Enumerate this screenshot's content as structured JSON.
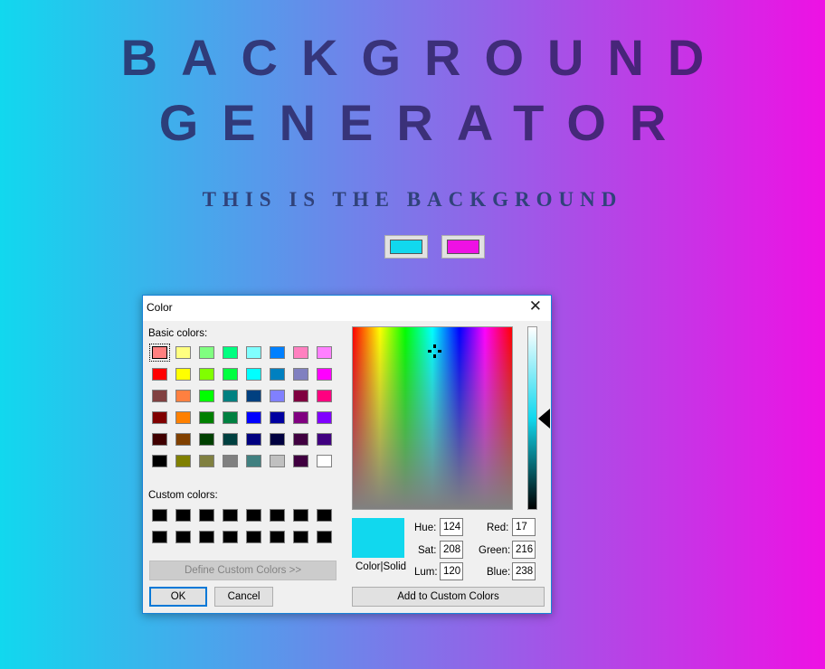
{
  "page": {
    "title_line1": "BACKGROUND",
    "title_line2": "GENERATOR",
    "subtitle": "THIS IS THE BACKGROUND",
    "color1": "#11d8ee",
    "color2": "#ee11e4"
  },
  "dialog": {
    "title": "Color",
    "close_icon": "close-icon",
    "basic_colors_label": "Basic colors:",
    "custom_colors_label": "Custom colors:",
    "basic_colors": [
      "#ff8080",
      "#ffff80",
      "#80ff80",
      "#00ff80",
      "#80ffff",
      "#0080ff",
      "#ff80c0",
      "#ff80ff",
      "#ff0000",
      "#ffff00",
      "#80ff00",
      "#00ff40",
      "#00ffff",
      "#0080c0",
      "#8080c0",
      "#ff00ff",
      "#804040",
      "#ff8040",
      "#00ff00",
      "#008080",
      "#004080",
      "#8080ff",
      "#800040",
      "#ff0080",
      "#800000",
      "#ff8000",
      "#008000",
      "#008040",
      "#0000ff",
      "#0000a0",
      "#800080",
      "#8000ff",
      "#400000",
      "#804000",
      "#004000",
      "#004040",
      "#000080",
      "#000040",
      "#400040",
      "#400080",
      "#000000",
      "#808000",
      "#808040",
      "#808080",
      "#408080",
      "#c0c0c0",
      "#400040",
      "#ffffff"
    ],
    "custom_colors": [
      "#000000",
      "#000000",
      "#000000",
      "#000000",
      "#000000",
      "#000000",
      "#000000",
      "#000000",
      "#000000",
      "#000000",
      "#000000",
      "#000000",
      "#000000",
      "#000000",
      "#000000",
      "#000000"
    ],
    "define_custom_label": "Define Custom Colors >>",
    "ok_label": "OK",
    "cancel_label": "Cancel",
    "color_solid_label": "Color|Solid",
    "hue_label": "Hue:",
    "hue": "124",
    "sat_label": "Sat:",
    "sat": "208",
    "lum_label": "Lum:",
    "lum": "120",
    "red_label": "Red:",
    "red": "17",
    "green_label": "Green:",
    "green": "216",
    "blue_label": "Blue:",
    "blue": "238",
    "add_custom_label": "Add to Custom Colors",
    "selected_color": "#11d8ee"
  }
}
